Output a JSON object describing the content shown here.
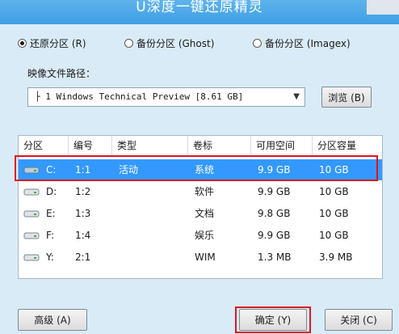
{
  "window": {
    "title": "U深度一键还原精灵"
  },
  "mode_options": [
    {
      "label": "还原分区 (R)",
      "selected": true
    },
    {
      "label": "备份分区 (Ghost)",
      "selected": false
    },
    {
      "label": "备份分区 (Imagex)",
      "selected": false
    }
  ],
  "image_path": {
    "label": "映像文件路径：",
    "value": "├ 1 Windows Technical Preview [8.61 GB]",
    "browse_label": "浏览 (B)"
  },
  "table": {
    "columns": [
      "分区",
      "编号",
      "类型",
      "卷标",
      "可用空间",
      "分区容量"
    ],
    "rows": [
      {
        "partition": "C:",
        "number": "1:1",
        "type": "活动",
        "label": "系统",
        "free": "9.9 GB",
        "size": "10 GB",
        "selected": true
      },
      {
        "partition": "D:",
        "number": "1:2",
        "type": "",
        "label": "软件",
        "free": "9.9 GB",
        "size": "10 GB",
        "selected": false
      },
      {
        "partition": "E:",
        "number": "1:3",
        "type": "",
        "label": "文档",
        "free": "9.8 GB",
        "size": "10 GB",
        "selected": false
      },
      {
        "partition": "F:",
        "number": "1:4",
        "type": "",
        "label": "娱乐",
        "free": "9.9 GB",
        "size": "10 GB",
        "selected": false
      },
      {
        "partition": "Y:",
        "number": "2:1",
        "type": "",
        "label": "WIM",
        "free": "1.3 MB",
        "size": "3.9 MB",
        "selected": false
      }
    ]
  },
  "buttons": {
    "advanced": "高级 (A)",
    "confirm": "确定 (Y)",
    "close": "关闭 (C)"
  },
  "colors": {
    "accent_selected": "#3399ff",
    "highlight_border": "#e0141e",
    "title_bar": "#3d9fe3"
  }
}
